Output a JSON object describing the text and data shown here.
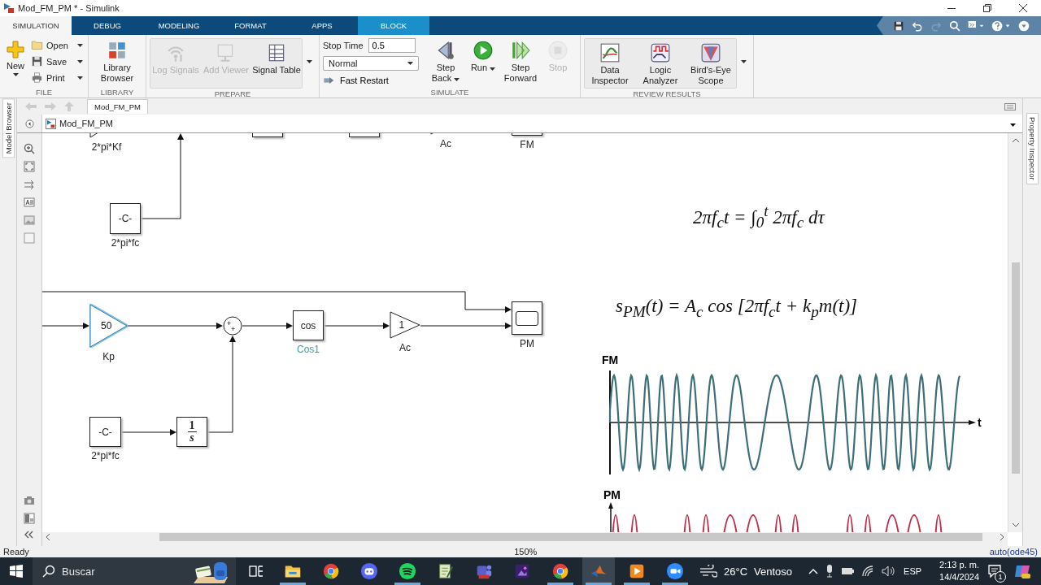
{
  "window": {
    "title": "Mod_FM_PM * - Simulink"
  },
  "tabs": [
    {
      "label": "SIMULATION",
      "selected": true,
      "kind": "main"
    },
    {
      "label": "DEBUG",
      "selected": false,
      "kind": "main"
    },
    {
      "label": "MODELING",
      "selected": false,
      "kind": "main"
    },
    {
      "label": "FORMAT",
      "selected": false,
      "kind": "main"
    },
    {
      "label": "APPS",
      "selected": false,
      "kind": "main"
    },
    {
      "label": "BLOCK",
      "selected": false,
      "kind": "contextual"
    }
  ],
  "ribbon": {
    "groups": [
      {
        "kind": "file",
        "label": "FILE",
        "items": [
          {
            "label": "New",
            "menu": true,
            "disabled": false
          },
          {
            "label": "Open",
            "menu": true,
            "disabled": false
          },
          {
            "label": "Save",
            "menu": true,
            "disabled": false
          },
          {
            "label": "Print",
            "menu": true,
            "disabled": false
          }
        ]
      },
      {
        "kind": "large",
        "label": "LIBRARY",
        "items": [
          {
            "label": "Library Browser",
            "menu": false,
            "disabled": false
          }
        ]
      },
      {
        "kind": "large",
        "label": "PREPARE",
        "more": true,
        "items": [
          {
            "label": "Log Signals",
            "menu": false,
            "disabled": true
          },
          {
            "label": "Add Viewer",
            "menu": false,
            "disabled": true
          },
          {
            "label": "Signal Table",
            "menu": false,
            "disabled": false
          }
        ]
      },
      {
        "kind": "simulate",
        "label": "SIMULATE",
        "stop_time_label": "Stop Time",
        "stop_time": "0.5",
        "mode": "Normal",
        "fast_restart": "Fast Restart",
        "items": [
          {
            "label": "Step Back",
            "menu": true,
            "disabled": false
          },
          {
            "label": "Run",
            "menu": true,
            "disabled": false
          },
          {
            "label": "Step Forward",
            "menu": false,
            "disabled": false
          },
          {
            "label": "Stop",
            "menu": false,
            "disabled": true
          }
        ]
      },
      {
        "kind": "large",
        "label": "REVIEW RESULTS",
        "more": true,
        "items": [
          {
            "label": "Data Inspector",
            "menu": false,
            "disabled": false
          },
          {
            "label": "Logic Analyzer",
            "menu": false,
            "disabled": false
          },
          {
            "label": "Bird's-Eye Scope",
            "menu": false,
            "disabled": false
          }
        ]
      }
    ]
  },
  "side_panels": {
    "left": "Model Browser",
    "right": "Property Inspector"
  },
  "document": {
    "tab": "Mod_FM_PM",
    "breadcrumb": "Mod_FM_PM"
  },
  "diagram": {
    "blocks": [
      {
        "kind": "gain",
        "caption": "2*pi*Kf",
        "selected": false,
        "highlighted": false
      },
      {
        "kind": "block",
        "selected": false
      },
      {
        "kind": "block",
        "selected": false
      },
      {
        "kind": "gain",
        "caption": "Ac",
        "selected": false,
        "highlighted": false
      },
      {
        "kind": "scope",
        "caption": "FM",
        "selected": false,
        "highlighted": false
      },
      {
        "kind": "constant",
        "text": "-C-",
        "caption": "2*pi*fc",
        "selected": false,
        "highlighted": false
      },
      {
        "kind": "gain",
        "text": "50",
        "caption": "Kp",
        "selected": true,
        "highlighted": false
      },
      {
        "kind": "sum",
        "signs": [
          "+",
          "+"
        ],
        "selected": false
      },
      {
        "kind": "function",
        "text": "cos",
        "caption": "Cos1",
        "selected": false,
        "highlighted": true
      },
      {
        "kind": "gain",
        "text": "1",
        "caption": "Ac",
        "selected": false,
        "highlighted": false
      },
      {
        "kind": "scope",
        "caption": "PM",
        "selected": false,
        "highlighted": false
      },
      {
        "kind": "constant",
        "text": "-C-",
        "caption": "2*pi*fc",
        "selected": false,
        "highlighted": false
      },
      {
        "kind": "integrator",
        "numerator": "1",
        "denominator": "s",
        "selected": false
      }
    ],
    "equations": [
      "2πf$_{c}$t = ∫$_{0}$$^{t}$ 2πf$_{c}$ dτ",
      "s$_{PM}$(t) = A$_{c}$ cos [2πf$_{c}$t + k$_{p}$m(t)]"
    ],
    "figure": {
      "fm_label": "FM",
      "time_label": "t",
      "pm_label": "PM"
    }
  },
  "status_bar": {
    "state": "Ready",
    "zoom": "150%",
    "solver": "auto(ode45)"
  },
  "taskbar": {
    "search_placeholder": "Buscar",
    "temperature": "26°C",
    "condition": "Ventoso",
    "language": "ESP",
    "time": "2:13 p. m.",
    "date": "14/4/2024",
    "notifications": "1",
    "apps": [
      {
        "kind": "folder",
        "running": true,
        "active": false
      },
      {
        "kind": "browser",
        "running": false,
        "active": false
      },
      {
        "kind": "chat",
        "running": false,
        "active": false
      },
      {
        "kind": "music",
        "running": true,
        "active": false
      },
      {
        "kind": "notepad",
        "running": false,
        "active": false
      },
      {
        "kind": "team",
        "running": false,
        "active": false
      },
      {
        "kind": "photo",
        "running": false,
        "active": false
      },
      {
        "kind": "browser",
        "running": true,
        "active": false
      },
      {
        "kind": "peak",
        "running": true,
        "active": true
      },
      {
        "kind": "player",
        "running": true,
        "active": false
      },
      {
        "kind": "video",
        "running": true,
        "active": false
      }
    ]
  }
}
